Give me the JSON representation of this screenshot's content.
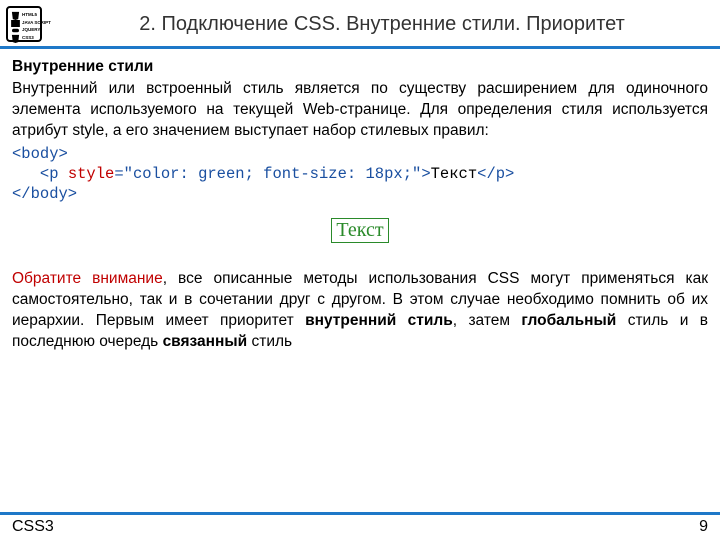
{
  "header": {
    "title": "2. Подключение CSS. Внутренние стили. Приоритет",
    "badge": {
      "t1": "HTML5",
      "t2": "JAVA SCRIPT",
      "t3": "JQUERY",
      "t4": "CSS3"
    }
  },
  "section": {
    "heading": "Внутренние стили",
    "para1": "Внутренний или встроенный стиль является по существу расширением для одиночного элемента используемого на текущей Web-странице. Для определения стиля используется атрибут style, а его значением выступает набор стилевых правил:"
  },
  "code": {
    "body_open": "<body>",
    "p_open_lt": "<",
    "p_open_tag": "p ",
    "attr_name": "style",
    "eq": "=",
    "attr_val": "\"color: green; font-size: 18px;\"",
    "p_open_gt": ">",
    "text": "Текст",
    "p_close": "</p>",
    "body_close": "</body>"
  },
  "render": {
    "text": "Текст"
  },
  "attention": {
    "lead": "Обратите внимание",
    "rest1": ", все описанные методы использования CSS могут применяться как самостоятельно, так и в сочетании друг с другом. В этом случае необходимо помнить об их иерархии. Первым имеет приоритет ",
    "b1": "внутренний стиль",
    "rest2": ", затем ",
    "b2": "глобальный",
    "rest3": " стиль и в последнюю очередь ",
    "b3": "связанный",
    "rest4": " стиль"
  },
  "footer": {
    "left": "CSS3",
    "page": "9"
  }
}
